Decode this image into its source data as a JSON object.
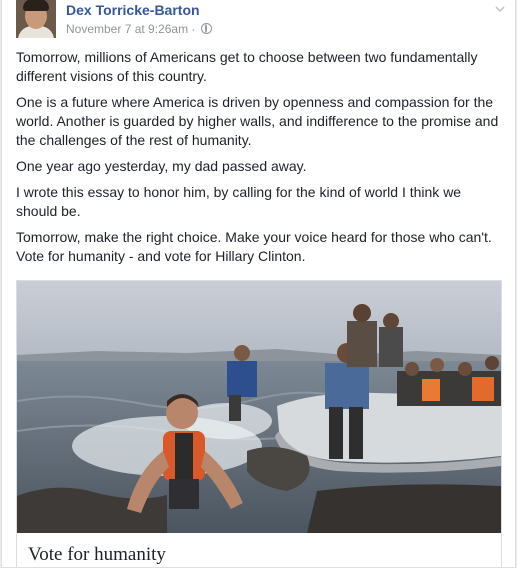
{
  "post": {
    "author": "Dex Torricke-Barton",
    "timestamp": "November 7 at 9:26am",
    "separator": "·",
    "privacy_icon": "globe-icon",
    "menu_icon": "chevron-down-icon",
    "paragraphs": [
      "Tomorrow, millions of Americans get to choose between two fundamentally different visions of this country.",
      "One is a future where America is driven by openness and compassion for the world. Another is guarded by higher walls, and indifference to the promise and the challenges of the rest of humanity.",
      "One year ago yesterday, my dad passed away.",
      "I wrote this essay to honor him, by calling for the kind of world I think we should be.",
      "Tomorrow, make the right choice. Make your voice heard for those who can't. Vote for humanity - and vote for Hillary Clinton."
    ],
    "attachment": {
      "title": "Vote for humanity"
    }
  },
  "colors": {
    "author_link": "#365899",
    "text": "#1d2129",
    "meta": "#90949c",
    "background": "#e9ebee"
  }
}
